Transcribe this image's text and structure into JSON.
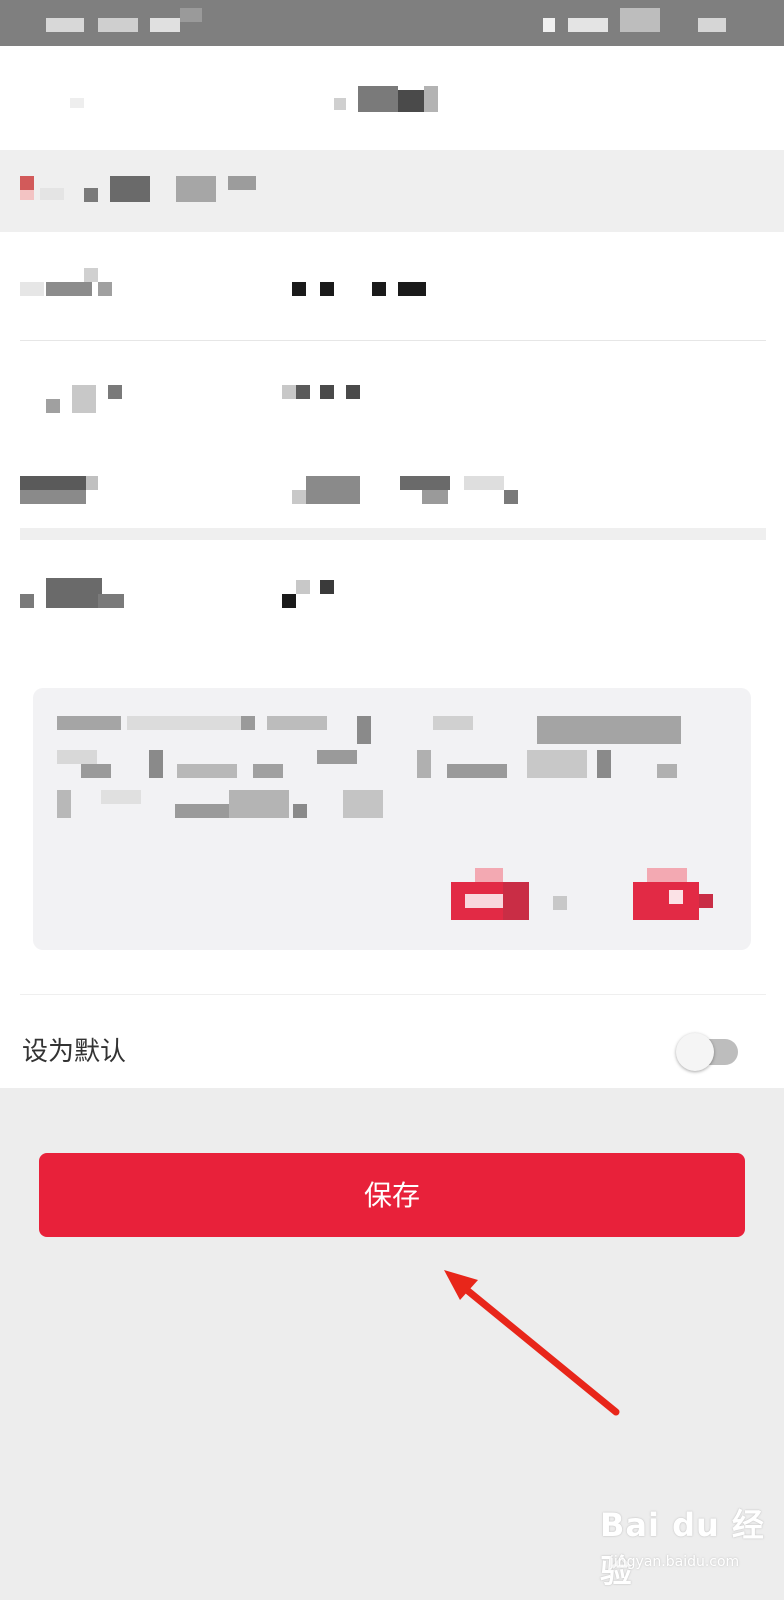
{
  "default_setting": {
    "label": "设为默认",
    "enabled": false
  },
  "save_button": {
    "label": "保存",
    "color": "#e8213a"
  },
  "watermark": {
    "brand": "Bai du 经验",
    "url": "jingyan.baidu.com"
  },
  "colors": {
    "status_bar": "#7f7f7f",
    "page_background": "#ededed",
    "annotation_arrow": "#e8261a"
  }
}
